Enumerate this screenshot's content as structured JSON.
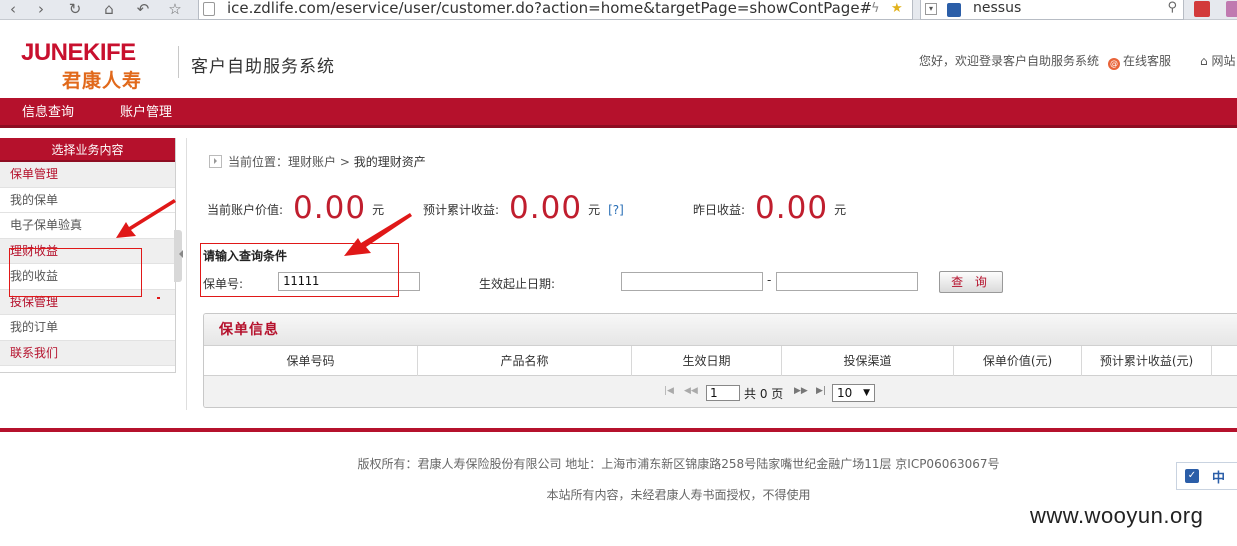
{
  "browser": {
    "url": "ice.zdlife.com/eservice/user/customer.do?action=home&targetPage=showContPage#",
    "search_text": "nessus"
  },
  "header": {
    "logo_en": "JUNEKIFE",
    "logo_cn": "君康人寿",
    "system_title": "客户自助服务系统",
    "welcome": "您好，欢迎登录客户自助服务系统",
    "online_service": "在线客服",
    "home_link": "网站"
  },
  "main_nav": [
    "信息查询",
    "账户管理"
  ],
  "sidebar": {
    "title": "选择业务内容",
    "items": [
      {
        "label": "保单管理",
        "type": "cat"
      },
      {
        "label": "我的保单",
        "type": "sub"
      },
      {
        "label": "电子保单验真",
        "type": "sub"
      },
      {
        "label": "理财收益",
        "type": "cat"
      },
      {
        "label": "我的收益",
        "type": "sub"
      },
      {
        "label": "投保管理",
        "type": "cat"
      },
      {
        "label": "我的订单",
        "type": "sub"
      },
      {
        "label": "联系我们",
        "type": "cat"
      }
    ]
  },
  "breadcrumb": {
    "prefix": "当前位置：理财账户 >",
    "current": "我的理财资产"
  },
  "stats": {
    "account_value_label": "当前账户价值:",
    "account_value": "0.00",
    "expected_income_label": "预计累计收益:",
    "expected_income": "0.00",
    "help": "[?]",
    "yesterday_label": "昨日收益:",
    "yesterday": "0.00",
    "unit": "元"
  },
  "query": {
    "title": "请输入查询条件",
    "policy_label": "保单号:",
    "policy_value": "11111",
    "date_label": "生效起止日期:",
    "date_start": "",
    "date_end": "",
    "date_sep": "-",
    "button": "查 询"
  },
  "table": {
    "title": "保单信息",
    "columns": [
      "保单号码",
      "产品名称",
      "生效日期",
      "投保渠道",
      "保单价值(元)",
      "预计累计收益(元)"
    ]
  },
  "pager": {
    "page": "1",
    "total": "共 0 页",
    "page_size": "10"
  },
  "footer": {
    "copyright": "版权所有：君康人寿保险股份有限公司 地址：上海市浦东新区锦康路258号陆家嘴世纪金融广场11层 京ICP06063067号",
    "notice": "本站所有内容，未经君康人寿书面授权，不得使用",
    "lang": "中"
  },
  "watermark": "www.wooyun.org",
  "colors": {
    "brand": "#b5112c",
    "value": "#c01e2e",
    "annotation": "#e01818"
  }
}
